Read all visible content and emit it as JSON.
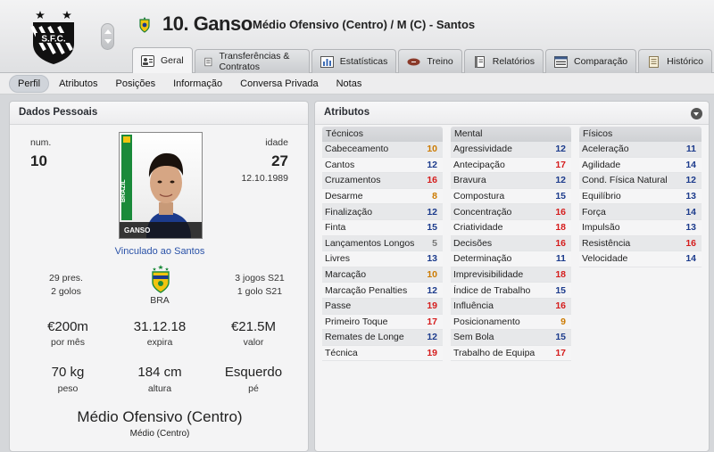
{
  "header": {
    "player_name": "10. Ganso",
    "player_subtitle": "Médio Ofensivo (Centro) / M (C) - Santos",
    "tabs": [
      {
        "label": "Geral",
        "icon": "profile-card-icon"
      },
      {
        "label": "Transferências & Contratos",
        "icon": "document-icon"
      },
      {
        "label": "Estatísticas",
        "icon": "bar-chart-icon"
      },
      {
        "label": "Treino",
        "icon": "football-icon"
      },
      {
        "label": "Relatórios",
        "icon": "notebook-icon"
      },
      {
        "label": "Comparação",
        "icon": "comparison-icon"
      },
      {
        "label": "Histórico",
        "icon": "scroll-icon"
      }
    ],
    "active_tab": "Geral"
  },
  "subnav": {
    "items": [
      "Perfil",
      "Atributos",
      "Posições",
      "Informação",
      "Conversa Privada",
      "Notas"
    ],
    "active": "Perfil"
  },
  "personal": {
    "title": "Dados Pessoais",
    "num_label": "num.",
    "num_value": "10",
    "age_label": "idade",
    "age_value": "27",
    "birth_date": "12.10.1989",
    "photo_caption": "GANSO",
    "photo_flag_text": "BRAZIL",
    "club_link": "Vinculado ao Santos",
    "caps": "29 pres.",
    "goals": "2 golos",
    "nation": "BRA",
    "u21_games": "3 jogos S21",
    "u21_goals": "1 golo S21",
    "wage_value": "€200m",
    "wage_label": "por mês",
    "expires_value": "31.12.18",
    "expires_label": "expira",
    "value_value": "€21.5M",
    "value_label": "valor",
    "weight_value": "70 kg",
    "weight_label": "peso",
    "height_value": "184 cm",
    "height_label": "altura",
    "foot_value": "Esquerdo",
    "foot_label": "pé",
    "position_full": "Médio Ofensivo (Centro)",
    "position_short": "Médio (Centro)"
  },
  "attributes": {
    "title": "Atributos",
    "columns": [
      {
        "header": "Técnicos",
        "rows": [
          {
            "name": "Cabeceamento",
            "value": "10"
          },
          {
            "name": "Cantos",
            "value": "12"
          },
          {
            "name": "Cruzamentos",
            "value": "16"
          },
          {
            "name": "Desarme",
            "value": "8"
          },
          {
            "name": "Finalização",
            "value": "12"
          },
          {
            "name": "Finta",
            "value": "15"
          },
          {
            "name": "Lançamentos Longos",
            "value": "5"
          },
          {
            "name": "Livres",
            "value": "13"
          },
          {
            "name": "Marcação",
            "value": "10"
          },
          {
            "name": "Marcação Penalties",
            "value": "12"
          },
          {
            "name": "Passe",
            "value": "19"
          },
          {
            "name": "Primeiro Toque",
            "value": "17"
          },
          {
            "name": "Remates de Longe",
            "value": "12"
          },
          {
            "name": "Técnica",
            "value": "19"
          }
        ]
      },
      {
        "header": "Mental",
        "rows": [
          {
            "name": "Agressividade",
            "value": "12"
          },
          {
            "name": "Antecipação",
            "value": "17"
          },
          {
            "name": "Bravura",
            "value": "12"
          },
          {
            "name": "Compostura",
            "value": "15"
          },
          {
            "name": "Concentração",
            "value": "16"
          },
          {
            "name": "Criatividade",
            "value": "18"
          },
          {
            "name": "Decisões",
            "value": "16"
          },
          {
            "name": "Determinação",
            "value": "11"
          },
          {
            "name": "Imprevisibilidade",
            "value": "18"
          },
          {
            "name": "Índice de Trabalho",
            "value": "15"
          },
          {
            "name": "Influência",
            "value": "16"
          },
          {
            "name": "Posicionamento",
            "value": "9"
          },
          {
            "name": "Sem Bola",
            "value": "15"
          },
          {
            "name": "Trabalho de Equipa",
            "value": "17"
          }
        ]
      },
      {
        "header": "Físicos",
        "rows": [
          {
            "name": "Aceleração",
            "value": "11"
          },
          {
            "name": "Agilidade",
            "value": "14"
          },
          {
            "name": "Cond. Física Natural",
            "value": "12"
          },
          {
            "name": "Equilíbrio",
            "value": "13"
          },
          {
            "name": "Força",
            "value": "14"
          },
          {
            "name": "Impulsão",
            "value": "13"
          },
          {
            "name": "Resistência",
            "value": "16"
          },
          {
            "name": "Velocidade",
            "value": "14"
          }
        ]
      }
    ]
  },
  "colors": {
    "value_low": "#777777",
    "value_mid": "#cc7a00",
    "value_good": "#1c3b8c",
    "value_high": "#d51c1c",
    "link": "#2a52a8"
  }
}
